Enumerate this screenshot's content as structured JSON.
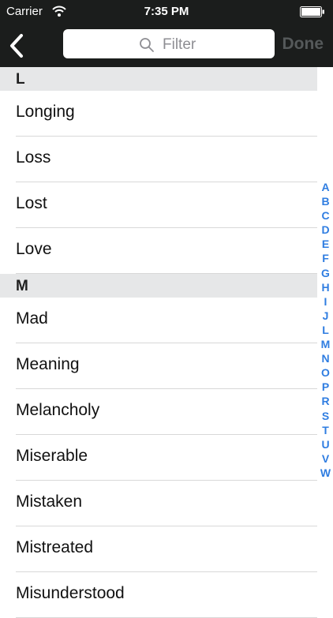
{
  "status": {
    "carrier": "Carrier",
    "time": "7:35 PM"
  },
  "nav": {
    "search_placeholder": "Filter",
    "done_label": "Done"
  },
  "sections": [
    {
      "title": "L",
      "items": [
        "Longing",
        "Loss",
        "Lost",
        "Love"
      ]
    },
    {
      "title": "M",
      "items": [
        "Mad",
        "Meaning",
        "Melancholy",
        "Miserable",
        "Mistaken",
        "Mistreated",
        "Misunderstood"
      ]
    }
  ],
  "index": [
    "A",
    "B",
    "C",
    "D",
    "E",
    "F",
    "G",
    "H",
    "I",
    "J",
    "L",
    "M",
    "N",
    "O",
    "P",
    "R",
    "S",
    "T",
    "U",
    "V",
    "W"
  ],
  "colors": {
    "nav_bg": "#1b1d1c",
    "index_accent": "#2f7de1",
    "section_bg": "#e6e7e8"
  }
}
